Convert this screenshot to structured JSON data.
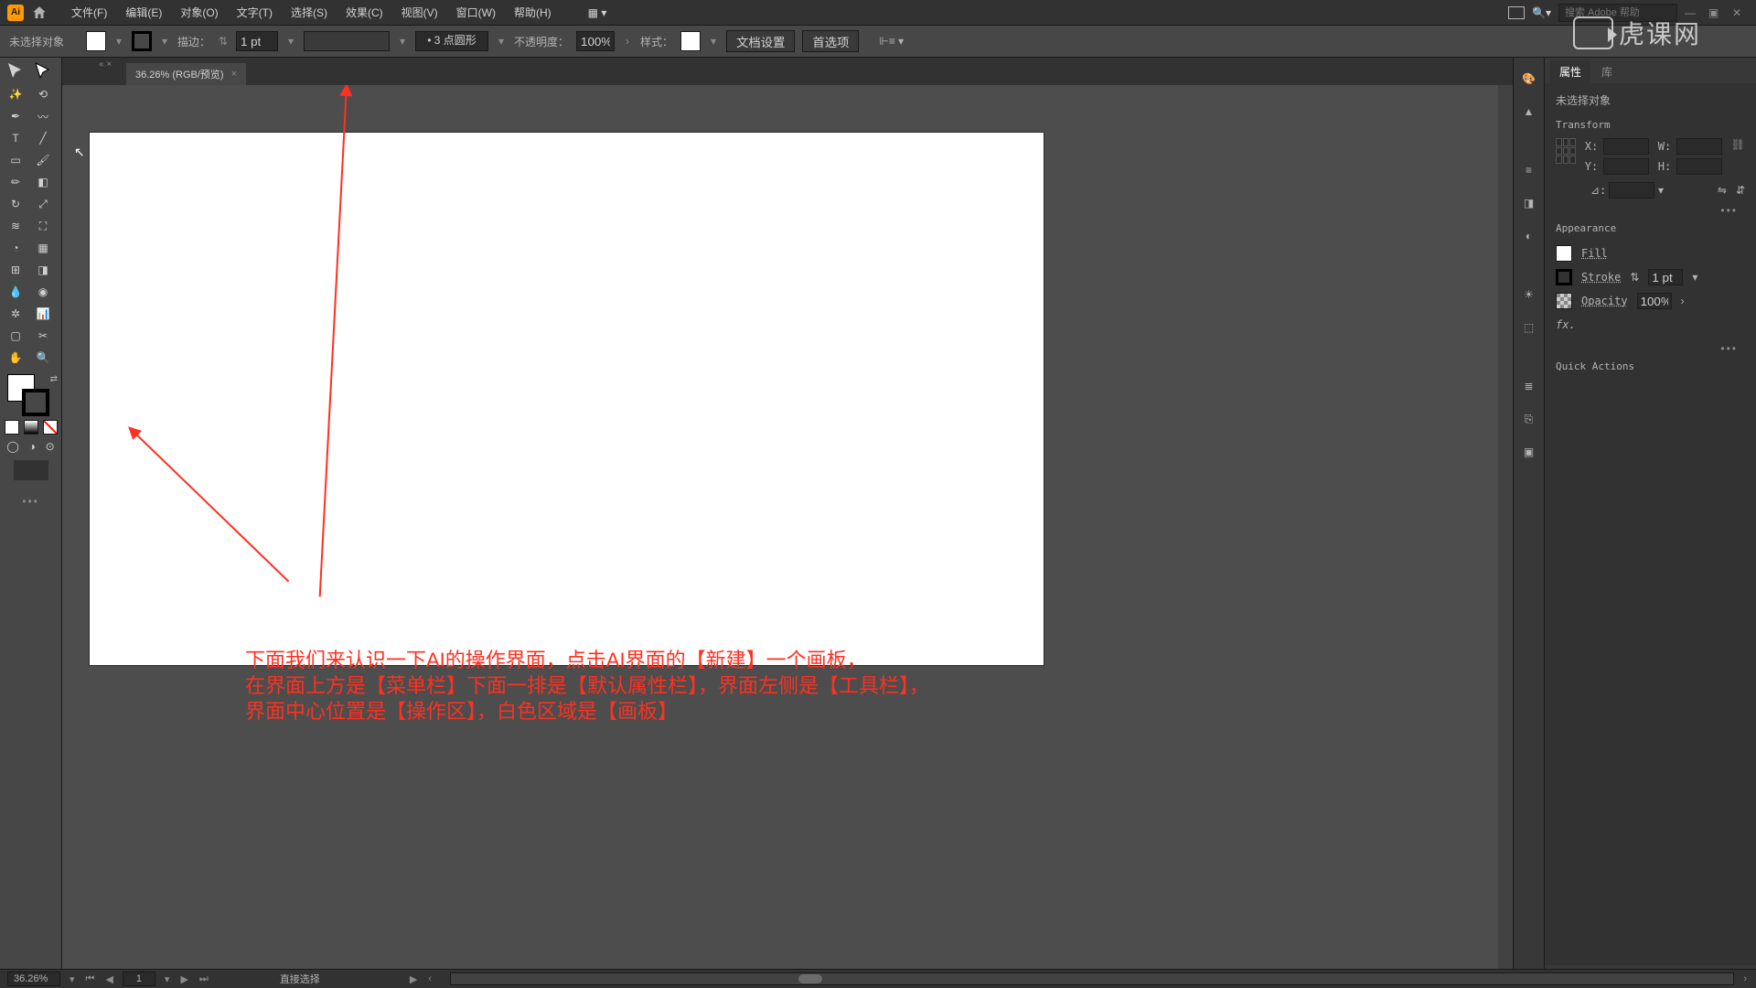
{
  "menubar": {
    "items": [
      "文件(F)",
      "编辑(E)",
      "对象(O)",
      "文字(T)",
      "选择(S)",
      "效果(C)",
      "视图(V)",
      "窗口(W)",
      "帮助(H)"
    ],
    "search_placeholder": "搜索 Adobe 帮助"
  },
  "controlbar": {
    "no_selection": "未选择对象",
    "stroke_label": "描边：",
    "stroke_value": "1 pt",
    "brush_value": "3 点圆形",
    "opacity_label": "不透明度：",
    "opacity_value": "100%",
    "style_label": "样式：",
    "doc_setup": "文档设置",
    "prefs": "首选项"
  },
  "tab": {
    "title": "36.26% (RGB/预览)"
  },
  "annotation": {
    "line1": "下面我们来认识一下AI的操作界面，点击AI界面的【新建】一个画板，",
    "line2": "在界面上方是【菜单栏】下面一排是【默认属性栏】，界面左侧是【工具栏】，",
    "line3": "界面中心位置是【操作区】，白色区域是【画板】"
  },
  "right_panel": {
    "tab_props": "属性",
    "tab_lib": "库",
    "no_selection": "未选择对象",
    "transform_title": "Transform",
    "x_label": "X:",
    "y_label": "Y:",
    "w_label": "W:",
    "h_label": "H:",
    "x_val": "",
    "y_val": "",
    "w_val": "",
    "h_val": "",
    "angle_label": "⊿:",
    "appearance_title": "Appearance",
    "fill_label": "Fill",
    "stroke_label": "Stroke",
    "stroke_value": "1 pt",
    "opacity_label": "Opacity",
    "opacity_value": "100%",
    "fx_label": "fx.",
    "quick_actions": "Quick Actions"
  },
  "statusbar": {
    "zoom": "36.26%",
    "artboard": "1",
    "tool_hint": "直接选择"
  },
  "watermark": "虎课网"
}
